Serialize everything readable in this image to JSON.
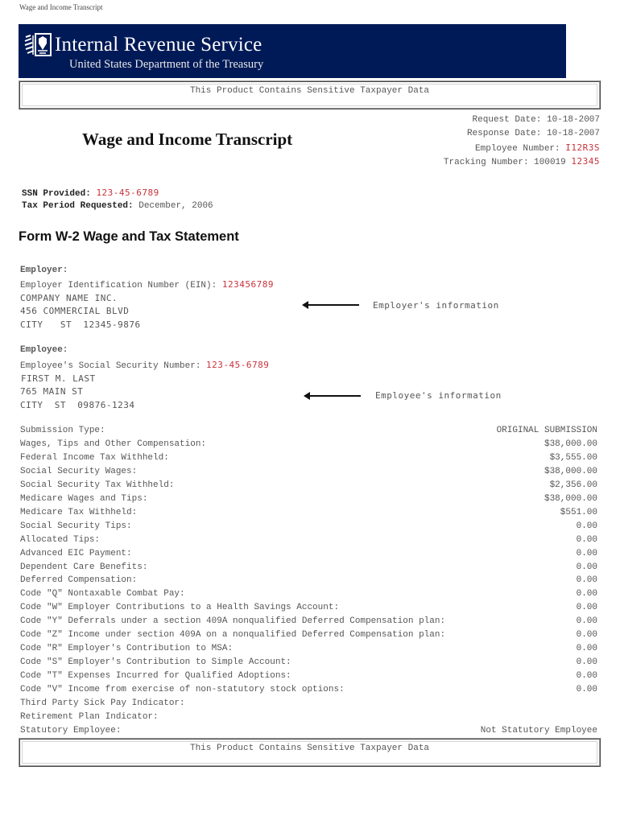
{
  "page_title": "Wage and Income Transcript",
  "banner": {
    "logo_icon": "irs-eagle-seal-icon",
    "agency_name": "Internal Revenue Service",
    "department": "United States Department of the Treasury",
    "background_color": "#001a57"
  },
  "sensitive_notice": "This Product Contains Sensitive Taxpayer Data",
  "header": {
    "title": "Wage and Income Transcript",
    "request_date_label": "Request Date:",
    "request_date": "10-18-2007",
    "response_date_label": "Response Date:",
    "response_date": "10-18-2007",
    "employee_number_label": "Employee Number:",
    "employee_number": "I12R3S",
    "tracking_number_label": "Tracking Number:",
    "tracking_number_prefix": "100019",
    "tracking_number_suffix": "12345"
  },
  "taxpayer": {
    "ssn_label": "SSN Provided:",
    "ssn": "123-45-6789",
    "tax_period_label": "Tax Period Requested:",
    "tax_period": "December, 2006"
  },
  "form": {
    "heading": "Form W-2 Wage and Tax Statement",
    "employer": {
      "section_label": "Employer:",
      "ein_label": "Employer Identification Number (EIN):",
      "ein": "123456789",
      "name": "COMPANY NAME INC.",
      "address": "456 COMMERCIAL BLVD",
      "city_state_zip": "CITY   ST  12345-9876",
      "annotation": "Employer's information"
    },
    "employee": {
      "section_label": "Employee:",
      "ssn_label": "Employee's Social Security Number:",
      "ssn": "123-45-6789",
      "name": "FIRST M. LAST",
      "address": "765 MAIN ST",
      "city_state_zip": "CITY  ST  09876-1234",
      "annotation": "Employee's information"
    },
    "rows": [
      {
        "label": "Submission Type:",
        "value": "ORIGINAL SUBMISSION"
      },
      {
        "label": "Wages, Tips and Other Compensation:",
        "value": "$38,000.00"
      },
      {
        "label": "Federal Income Tax Withheld:",
        "value": "$3,555.00"
      },
      {
        "label": "Social Security Wages:",
        "value": "$38,000.00"
      },
      {
        "label": "Social Security Tax Withheld:",
        "value": "$2,356.00"
      },
      {
        "label": "Medicare Wages and Tips:",
        "value": "$38,000.00"
      },
      {
        "label": "Medicare Tax Withheld:",
        "value": "$551.00"
      },
      {
        "label": "Social Security Tips:",
        "value": "0.00"
      },
      {
        "label": "Allocated Tips:",
        "value": "0.00"
      },
      {
        "label": "Advanced EIC Payment:",
        "value": "0.00"
      },
      {
        "label": "Dependent Care Benefits:",
        "value": "0.00"
      },
      {
        "label": "Deferred Compensation:",
        "value": "0.00"
      },
      {
        "label": "Code \"Q\" Nontaxable Combat Pay:",
        "value": "0.00"
      },
      {
        "label": "Code \"W\" Employer Contributions to a Health Savings Account:",
        "value": "0.00"
      },
      {
        "label": "Code \"Y\" Deferrals under a section 409A nonqualified Deferred Compensation plan:",
        "value": "0.00"
      },
      {
        "label": "Code \"Z\" Income under section 409A on a nonqualified Deferred Compensation plan:",
        "value": "0.00"
      },
      {
        "label": "Code \"R\" Employer's Contribution to MSA:",
        "value": "0.00"
      },
      {
        "label": "Code \"S\" Employer's Contribution to Simple Account:",
        "value": "0.00"
      },
      {
        "label": "Code \"T\" Expenses Incurred for Qualified Adoptions:",
        "value": "0.00"
      },
      {
        "label": "Code \"V\" Income from exercise of non-statutory stock options:",
        "value": "0.00"
      },
      {
        "label": "Third Party Sick Pay Indicator:",
        "value": ""
      },
      {
        "label": "Retirement Plan Indicator:",
        "value": ""
      },
      {
        "label": "Statutory Employee:",
        "value": "Not Statutory Employee"
      }
    ]
  }
}
